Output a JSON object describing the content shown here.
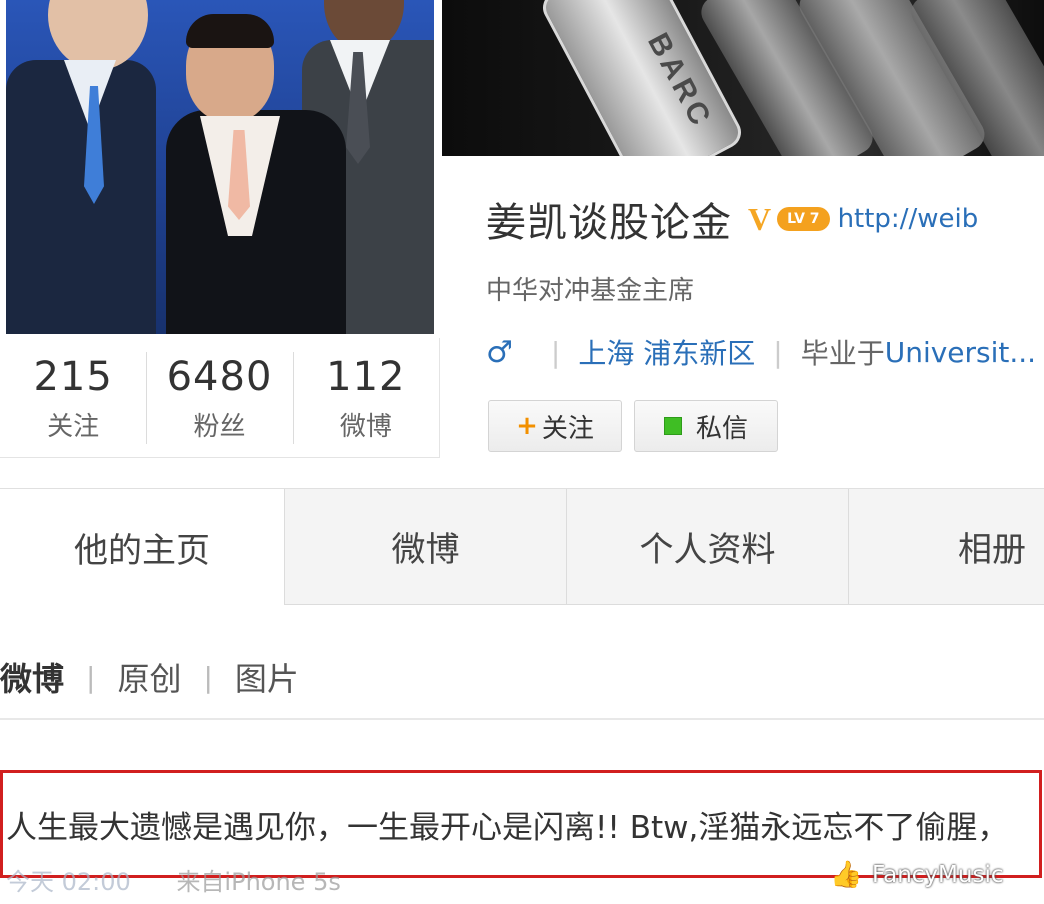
{
  "profile": {
    "name": "姜凯谈股论金",
    "verified_badge": "V",
    "level_badge": "LV 7",
    "url": "http://weib",
    "bio": "中华对冲基金主席",
    "gender_icon": "♂",
    "location": "上海 浦东新区",
    "education_prefix": "毕业于",
    "education_link": "Universit..."
  },
  "stats": [
    {
      "value": "215",
      "label": "关注"
    },
    {
      "value": "6480",
      "label": "粉丝"
    },
    {
      "value": "112",
      "label": "微博"
    }
  ],
  "buttons": {
    "follow": "关注",
    "follow_icon": "+",
    "message": "私信"
  },
  "cover": {
    "text": "BARC"
  },
  "tabs": [
    "他的主页",
    "微博",
    "个人资料",
    "相册"
  ],
  "filters": [
    "微博",
    "原创",
    "图片"
  ],
  "post": {
    "text": "人生最大遗憾是遇见你，一生最开心是闪离!! Btw,淫猫永远忘不了偷腥，",
    "time": "今天 02:00",
    "source": "来自iPhone 5s"
  },
  "watermark": "FancyMusic",
  "colors": {
    "link": "#2a6fb8",
    "badge_orange": "#f4a11e",
    "highlight_border": "#d11f1f",
    "message_green": "#3fbe24"
  },
  "icons": {
    "like": "thumbs-up-icon",
    "gender": "male-icon",
    "message": "message-icon",
    "follow": "plus-icon"
  }
}
